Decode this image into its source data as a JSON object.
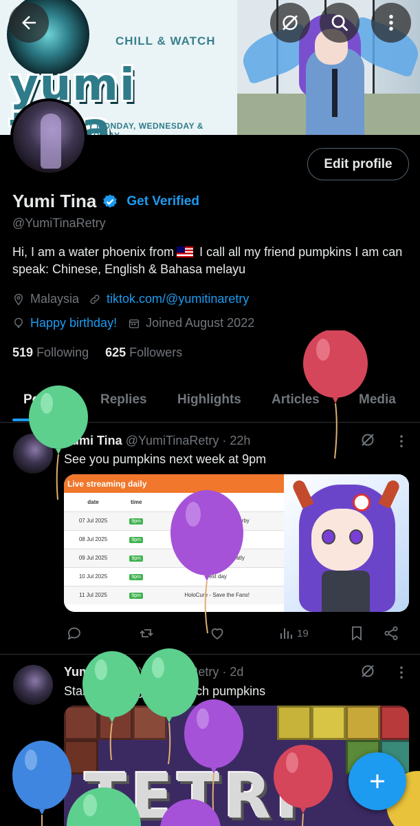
{
  "banner": {
    "tagline": "CHILL & WATCH",
    "title": "yumi tina",
    "schedule": "Y MONDAY, WEDNESDAY & FRIDAY"
  },
  "header": {
    "back_icon": "arrow-left-icon",
    "grok_icon": "grok-icon",
    "search_icon": "search-icon",
    "more_icon": "more-vertical-icon"
  },
  "profile": {
    "edit_label": "Edit profile",
    "name": "Yumi Tina",
    "get_verified": "Get Verified",
    "handle": "@YumiTinaRetry",
    "bio_part1": "Hi, I am a water phoenix from",
    "bio_part2": "I call all my friend pumpkins   I am can speak: Chinese, English & Bahasa melayu",
    "location": "Malaysia",
    "website": "tiktok.com/@yumitinaretry",
    "birthday": "Happy birthday!",
    "joined": "Joined August 2022",
    "following_count": "519",
    "following_label": "Following",
    "followers_count": "625",
    "followers_label": "Followers"
  },
  "tabs": [
    "Posts",
    "Replies",
    "Highlights",
    "Articles",
    "Media"
  ],
  "posts": [
    {
      "name": "Yumi Tina",
      "handle": "@YumiTinaRetry",
      "time": "· 22h",
      "text": "See you pumpkins next week at 9pm",
      "views": "19",
      "media": {
        "header": "Live streaming daily",
        "columns": [
          "date",
          "time",
          "games"
        ],
        "rows": [
          [
            "07 Jul 2025",
            "9pm",
            "Umamusume Pretty Derby"
          ],
          [
            "08 Jul 2025",
            "9pm",
            "rest day"
          ],
          [
            "09 Jul 2025",
            "9pm",
            "Cats Organized Neatly"
          ],
          [
            "10 Jul 2025",
            "9pm",
            "rest day"
          ],
          [
            "11 Jul 2025",
            "9pm",
            "HoloCure - Save the Fans!"
          ]
        ]
      }
    },
    {
      "name": "Yumi Tina",
      "handle": "@YumiTinaRetry",
      "time": "· 2d",
      "text": "Start missing you so much pumpkins",
      "media_text": "TETRI"
    }
  ],
  "fab_label": "+",
  "colors": {
    "accent": "#1d9bf0",
    "muted": "#71767b",
    "text": "#e7e9ea",
    "divider": "#2f3336"
  }
}
